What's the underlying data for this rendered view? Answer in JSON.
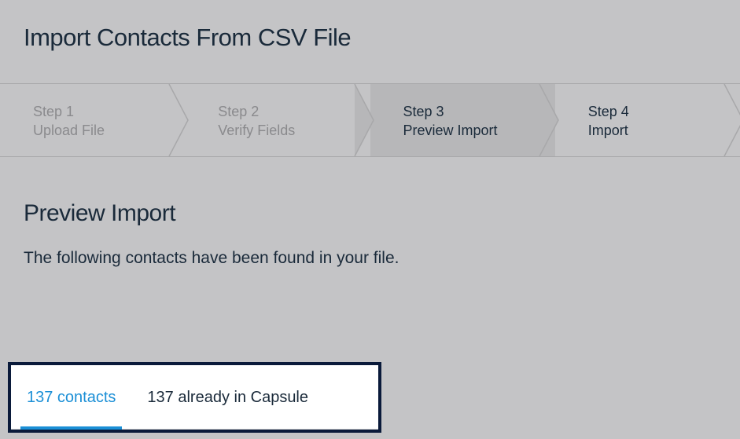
{
  "header": {
    "title": "Import Contacts From CSV File"
  },
  "stepper": {
    "steps": [
      {
        "label": "Step 1",
        "sub": "Upload File"
      },
      {
        "label": "Step 2",
        "sub": "Verify Fields"
      },
      {
        "label": "Step 3",
        "sub": "Preview Import"
      },
      {
        "label": "Step 4",
        "sub": "Import"
      }
    ]
  },
  "main": {
    "section_title": "Preview Import",
    "description": "The following contacts have been found in your file.",
    "tabs": [
      {
        "label": "137 contacts"
      },
      {
        "label": "137 already in Capsule"
      }
    ]
  }
}
